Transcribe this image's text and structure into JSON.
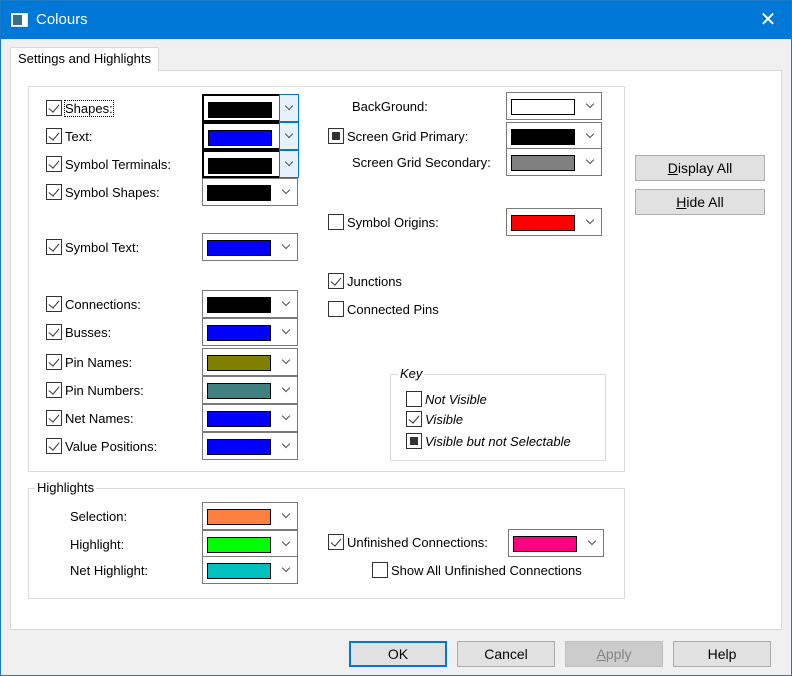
{
  "window": {
    "title": "Colours",
    "close_icon": "close-icon"
  },
  "tabs": [
    {
      "label": "Settings and Highlights",
      "active": true
    }
  ],
  "display_items_left": [
    {
      "label": "Shapes:",
      "state": "checked",
      "color": "#000000"
    },
    {
      "label": "Text:",
      "state": "checked",
      "color": "#0000ff"
    },
    {
      "label": "Symbol Terminals:",
      "state": "checked",
      "color": "#000000"
    },
    {
      "label": "Symbol Shapes:",
      "state": "checked",
      "color": "#000000"
    },
    {
      "label": "Symbol Text:",
      "state": "checked",
      "color": "#0000ff"
    },
    {
      "label": "Connections:",
      "state": "checked",
      "color": "#000000"
    },
    {
      "label": "Busses:",
      "state": "checked",
      "color": "#0000ff"
    },
    {
      "label": "Pin Names:",
      "state": "checked",
      "color": "#808000"
    },
    {
      "label": "Pin Numbers:",
      "state": "checked",
      "color": "#408080"
    },
    {
      "label": "Net Names:",
      "state": "checked",
      "color": "#0000ff"
    },
    {
      "label": "Value Positions:",
      "state": "checked",
      "color": "#0000ff"
    }
  ],
  "display_items_right": [
    {
      "label": "BackGround:",
      "state": "none",
      "color": "#ffffff"
    },
    {
      "label": "Screen Grid Primary:",
      "state": "filled",
      "color": "#000000"
    },
    {
      "label": "Screen Grid Secondary:",
      "state": "none",
      "color": "#808080"
    },
    {
      "label": "Symbol Origins:",
      "state": "unchecked",
      "color": "#ff0000"
    }
  ],
  "toggles": [
    {
      "label": "Junctions",
      "state": "checked"
    },
    {
      "label": "Connected Pins",
      "state": "unchecked"
    }
  ],
  "key": {
    "title": "Key",
    "items": [
      {
        "label": "Not Visible",
        "state": "unchecked"
      },
      {
        "label": "Visible",
        "state": "checked"
      },
      {
        "label": "Visible but not Selectable",
        "state": "filled"
      }
    ]
  },
  "side_buttons": {
    "display_all": {
      "pre": "",
      "mnemonic": "D",
      "post": "isplay All"
    },
    "hide_all": {
      "pre": "",
      "mnemonic": "H",
      "post": "ide All"
    }
  },
  "highlights": {
    "title": "Highlights",
    "items": [
      {
        "label": "Selection:",
        "color": "#ff8040"
      },
      {
        "label": "Highlight:",
        "color": "#00ff00"
      },
      {
        "label": "Net Highlight:",
        "color": "#00c0c0"
      }
    ],
    "unfinished": {
      "label": "Unfinished Connections:",
      "state": "checked",
      "color": "#ff0080"
    },
    "show_all_unfinished": {
      "label": "Show All Unfinished Connections",
      "state": "unchecked"
    }
  },
  "footer": {
    "ok": "OK",
    "cancel": "Cancel",
    "apply": {
      "pre": "",
      "mnemonic": "A",
      "post": "pply",
      "disabled": true
    },
    "help": "Help"
  }
}
